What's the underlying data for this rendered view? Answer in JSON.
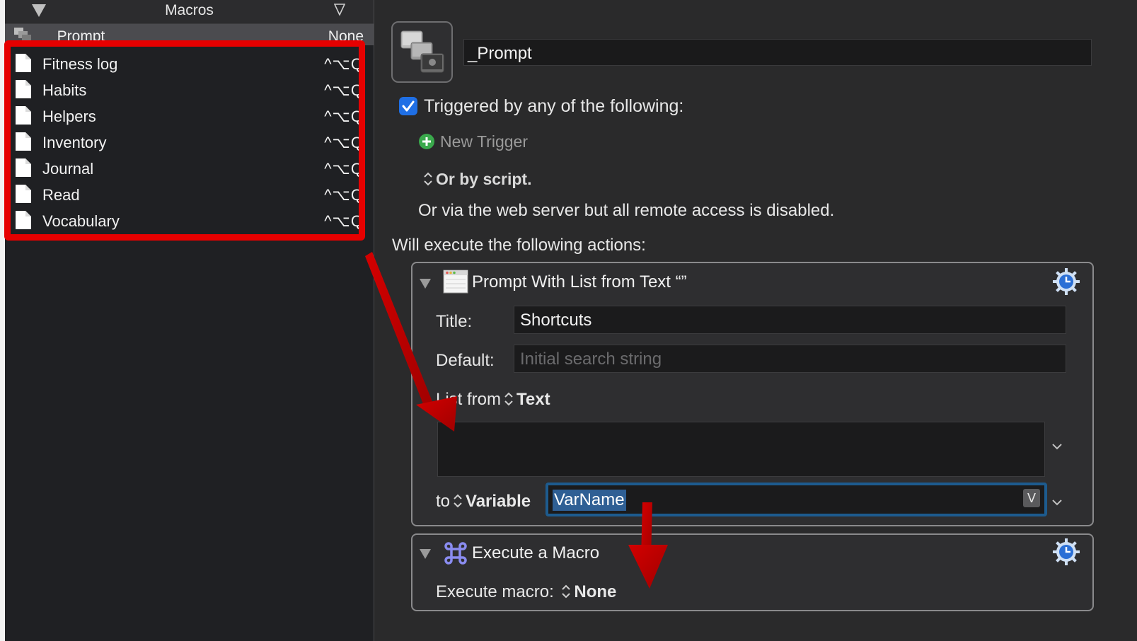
{
  "left_pane": {
    "header_title": "Macros",
    "selected_macro": {
      "name": "_Prompt",
      "trigger": "None"
    },
    "macros": [
      {
        "name": "Fitness log",
        "shortcut": "^⌥Q"
      },
      {
        "name": "Habits",
        "shortcut": "^⌥Q"
      },
      {
        "name": "Helpers",
        "shortcut": "^⌥Q"
      },
      {
        "name": "Inventory",
        "shortcut": "^⌥Q"
      },
      {
        "name": "Journal",
        "shortcut": "^⌥Q"
      },
      {
        "name": "Read",
        "shortcut": "^⌥Q"
      },
      {
        "name": "Vocabulary",
        "shortcut": "^⌥Q"
      }
    ]
  },
  "editor": {
    "macro_name": "_Prompt",
    "triggered_label": "Triggered by any of the following:",
    "new_trigger_label": "New Trigger",
    "or_by_script_label": "Or by script.",
    "web_server_note": "Or via the web server but all remote access is disabled.",
    "will_execute_label": "Will execute the following actions:",
    "actions": [
      {
        "title": "Prompt With List from Text “”",
        "title_label": "Title:",
        "title_value": "Shortcuts",
        "default_label": "Default:",
        "default_placeholder": "Initial search string",
        "list_from_label": "List from",
        "list_from_value": "Text",
        "list_text_value": "",
        "to_label": "to",
        "to_value": "Variable",
        "variable_name": "VarName",
        "variable_button": "V"
      },
      {
        "title": "Execute a Macro",
        "execute_label": "Execute macro:",
        "execute_value": "None"
      }
    ]
  },
  "colors": {
    "highlight": "#e60000",
    "checkbox": "#1f6fe5",
    "focus_ring": "#1d5b8e",
    "selection": "#2f5f94"
  }
}
